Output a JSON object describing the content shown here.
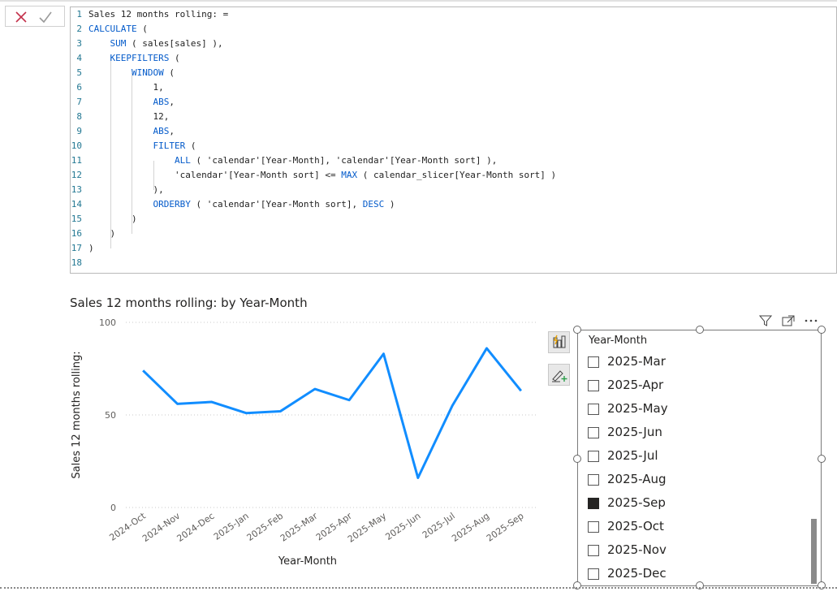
{
  "toolbar": {
    "cancel_icon": "close-x-icon",
    "commit_icon": "checkmark-icon"
  },
  "editor": {
    "lines": [
      {
        "n": "1",
        "text": "Sales 12 months rolling: ="
      },
      {
        "n": "2",
        "text": "CALCULATE ("
      },
      {
        "n": "3",
        "text": "    SUM ( sales[sales] ),"
      },
      {
        "n": "4",
        "text": "    KEEPFILTERS ("
      },
      {
        "n": "5",
        "text": "        WINDOW ("
      },
      {
        "n": "6",
        "text": "            1,"
      },
      {
        "n": "7",
        "text": "            ABS,"
      },
      {
        "n": "8",
        "text": "            12,"
      },
      {
        "n": "9",
        "text": "            ABS,"
      },
      {
        "n": "10",
        "text": "            FILTER ("
      },
      {
        "n": "11",
        "text": "                ALL ( 'calendar'[Year-Month], 'calendar'[Year-Month sort] ),"
      },
      {
        "n": "12",
        "text": "                'calendar'[Year-Month sort] <= MAX ( calendar_slicer[Year-Month sort] )"
      },
      {
        "n": "13",
        "text": "            ),"
      },
      {
        "n": "14",
        "text": "            ORDERBY ( 'calendar'[Year-Month sort], DESC )"
      },
      {
        "n": "15",
        "text": "        )"
      },
      {
        "n": "16",
        "text": "    )"
      },
      {
        "n": "17",
        "text": ")"
      },
      {
        "n": "18",
        "text": ""
      }
    ]
  },
  "visual": {
    "title": "Sales 12 months rolling: by Year-Month",
    "format_icon": "build-visual-icon",
    "analytics_icon": "format-brush-plus-icon"
  },
  "chart_data": {
    "type": "line",
    "title": "Sales 12 months rolling: by Year-Month",
    "xlabel": "Year-Month",
    "ylabel": "Sales 12 months rolling:",
    "categories": [
      "2024-Oct",
      "2024-Nov",
      "2024-Dec",
      "2025-Jan",
      "2025-Feb",
      "2025-Mar",
      "2025-Apr",
      "2025-May",
      "2025-Jun",
      "2025-Jul",
      "2025-Aug",
      "2025-Sep"
    ],
    "values": [
      74,
      56,
      57,
      51,
      52,
      64,
      58,
      83,
      16,
      55,
      86,
      63
    ],
    "yticks": [
      "0",
      "50",
      "100"
    ],
    "ylim": [
      0,
      100
    ],
    "grid": true,
    "color": "#118DFF"
  },
  "slicer": {
    "title": "Year-Month",
    "header_icons": [
      "filter-icon",
      "focus-mode-icon",
      "more-options-icon"
    ],
    "items": [
      {
        "label": "2025-Mar",
        "checked": false
      },
      {
        "label": "2025-Apr",
        "checked": false
      },
      {
        "label": "2025-May",
        "checked": false
      },
      {
        "label": "2025-Jun",
        "checked": false
      },
      {
        "label": "2025-Jul",
        "checked": false
      },
      {
        "label": "2025-Aug",
        "checked": false
      },
      {
        "label": "2025-Sep",
        "checked": true
      },
      {
        "label": "2025-Oct",
        "checked": false
      },
      {
        "label": "2025-Nov",
        "checked": false
      },
      {
        "label": "2025-Dec",
        "checked": false
      }
    ]
  }
}
